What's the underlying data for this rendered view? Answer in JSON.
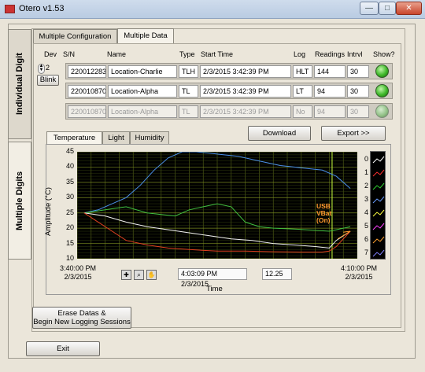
{
  "window": {
    "title": "Otero v1.53"
  },
  "side_tabs": {
    "individual": "Individual Digit",
    "multiple": "Multiple Digits"
  },
  "top_tabs": {
    "config": "Multiple Configuration",
    "data": "Multiple Data"
  },
  "columns": {
    "dev": "Dev",
    "sn": "S/N",
    "name": "Name",
    "type": "Type",
    "start": "Start Time",
    "log": "Log",
    "readings": "Readings",
    "intrvl": "Intrvl",
    "show": "Show?"
  },
  "dev_value": "2",
  "blink_label": "Blink",
  "devices": [
    {
      "sn": "220012283",
      "name": "Location-Charlie",
      "type": "TLH",
      "start": "2/3/2015 3:42:39 PM",
      "log": "HLT",
      "readings": "144",
      "intrvl": "30",
      "show": true
    },
    {
      "sn": "220010870",
      "name": "Location-Alpha",
      "type": "TL",
      "start": "2/3/2015 3:42:39 PM",
      "log": "LT",
      "readings": "94",
      "intrvl": "30",
      "show": true
    },
    {
      "sn": "220010870",
      "name": "Location-Alpha",
      "type": "TL",
      "start": "2/3/2015 3:42:39 PM",
      "log": "No",
      "readings": "94",
      "intrvl": "30",
      "show": false
    }
  ],
  "download_label": "Download",
  "export_label": "Export >>",
  "chart_tabs": [
    "Temperature",
    "Light",
    "Humidity"
  ],
  "annotation": {
    "line1": "USB",
    "line2": "VBat",
    "line3": "(On)"
  },
  "readout": {
    "time": "4:03:09 PM 2/3/2015",
    "value": "12.25"
  },
  "erase_label": {
    "line1": "Erase Datas &",
    "line2": "Begin New Logging Sessions"
  },
  "exit_label": "Exit",
  "chart_data": {
    "type": "line",
    "ylabel": "Amplitude (°C)",
    "xlabel": "Time",
    "ylim": [
      10,
      45
    ],
    "yticks": [
      "45",
      "40",
      "35",
      "30",
      "25",
      "20",
      "15",
      "10"
    ],
    "x_start": {
      "time": "3:40:00 PM",
      "date": "2/3/2015"
    },
    "x_end": {
      "time": "4:10:00 PM",
      "date": "2/3/2015"
    },
    "grid": true,
    "legend_items": [
      "0",
      "1",
      "2",
      "3",
      "4",
      "5",
      "6",
      "7"
    ],
    "legend_colors": [
      "#ffffff",
      "#ff3030",
      "#30d030",
      "#6a9cff",
      "#ffff40",
      "#ff40ff",
      "#ffa030",
      "#8080ff"
    ],
    "series": [
      {
        "name": "3",
        "color": "#4a8fe8",
        "x": [
          0.5,
          1.5,
          2.5,
          3.5,
          4.5,
          5.5,
          6.5,
          7.5,
          8.5,
          9.5,
          10.5,
          11.5,
          12.5,
          13.5,
          14.5,
          15.5,
          16.5,
          17.5,
          18.5,
          19.5
        ],
        "y": [
          25,
          26,
          28,
          30,
          34,
          39,
          43,
          45,
          45,
          44.5,
          44,
          43.5,
          42.5,
          41.5,
          40.5,
          40,
          39.5,
          39,
          37,
          33
        ]
      },
      {
        "name": "2",
        "color": "#40c040",
        "x": [
          0.5,
          2,
          3.5,
          5,
          6,
          7,
          8,
          9,
          10,
          11,
          12,
          13,
          14,
          15,
          16,
          17,
          18,
          18.5,
          19.5
        ],
        "y": [
          25,
          26,
          27,
          25,
          24.5,
          24,
          26,
          27,
          28,
          27,
          22,
          20.5,
          20,
          19.8,
          19.6,
          19.3,
          19,
          19.5,
          20.5
        ]
      },
      {
        "name": "0",
        "color": "#f0f0f0",
        "x": [
          0.5,
          2,
          3.5,
          5,
          6.5,
          8,
          9.5,
          11,
          12.5,
          14,
          15.5,
          17,
          18,
          18.5,
          19.5
        ],
        "y": [
          25,
          24,
          22,
          20.5,
          19.5,
          18.5,
          17.5,
          16.5,
          16,
          15,
          14.5,
          14,
          13.5,
          16,
          19
        ]
      },
      {
        "name": "1",
        "color": "#e04020",
        "x": [
          0.5,
          1.5,
          2.5,
          3.5,
          5,
          6.5,
          8,
          10,
          12,
          14,
          16,
          17.5,
          18,
          18.5,
          19.5
        ],
        "y": [
          25,
          22,
          19,
          16,
          14.5,
          13.5,
          13,
          12.5,
          12.5,
          12.3,
          12.2,
          12.2,
          12.5,
          14,
          19
        ]
      }
    ],
    "marker_x": 18.2
  }
}
